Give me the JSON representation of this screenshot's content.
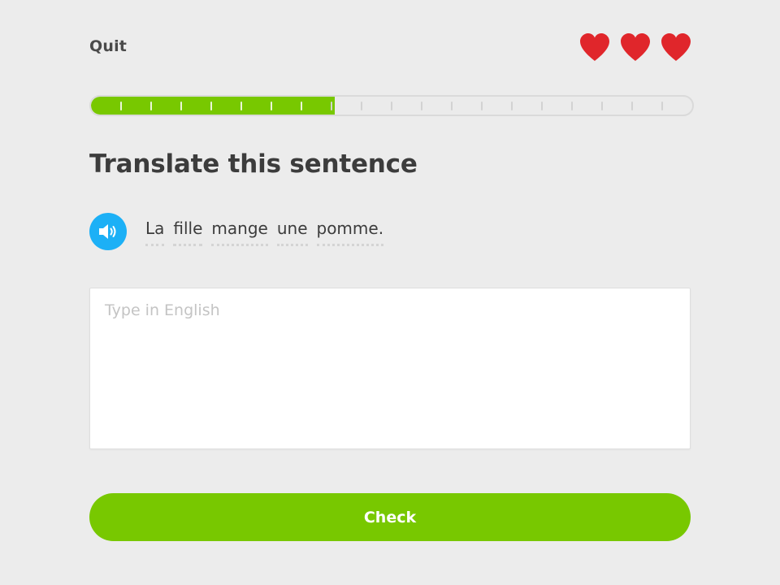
{
  "header": {
    "quit_label": "Quit",
    "hearts": {
      "count": 3,
      "color": "#e0262b",
      "icon": "heart-icon"
    }
  },
  "progress": {
    "fraction": 0.405,
    "segments_total": 20,
    "segments_completed": 8,
    "fill_color": "#78c800",
    "track_color": "#ebebeb"
  },
  "challenge": {
    "title": "Translate this sentence",
    "audio_icon": "speaker-icon",
    "audio_color": "#1cb0f6",
    "sentence_words": [
      "La",
      "fille",
      "mange",
      "une",
      "pomme."
    ]
  },
  "answer": {
    "placeholder": "Type in English",
    "value": ""
  },
  "footer": {
    "check_label": "Check",
    "check_color": "#78c800"
  }
}
